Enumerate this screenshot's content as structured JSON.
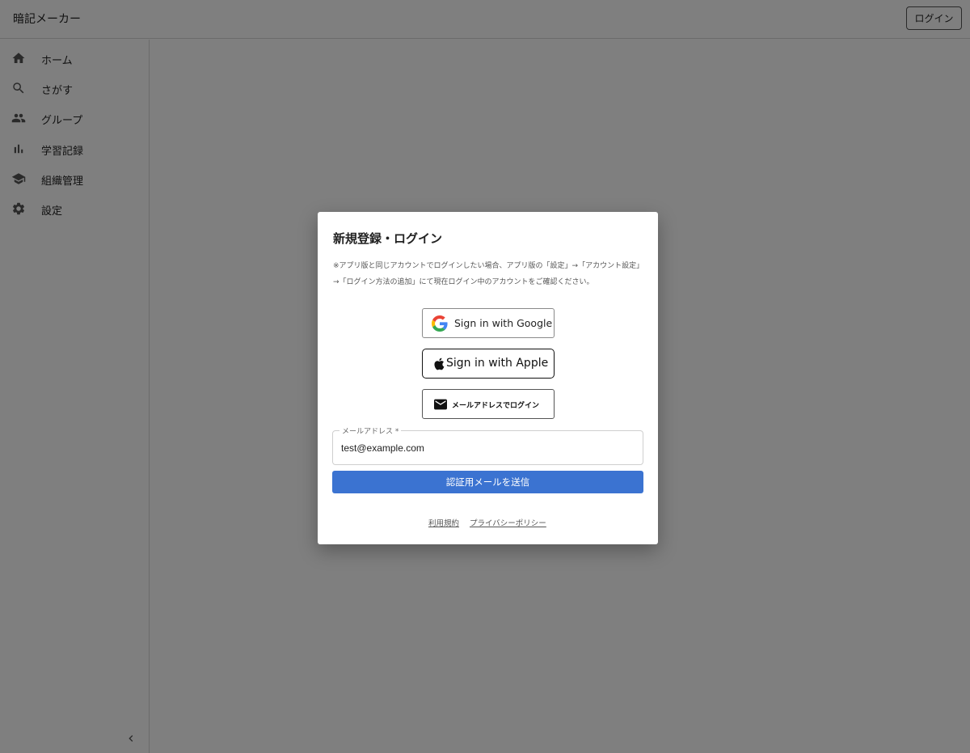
{
  "header": {
    "app_title": "暗記メーカー",
    "login_label": "ログイン"
  },
  "sidebar": {
    "items": [
      {
        "label": "ホーム",
        "icon": "home-icon"
      },
      {
        "label": "さがす",
        "icon": "search-icon"
      },
      {
        "label": "グループ",
        "icon": "group-icon"
      },
      {
        "label": "学習記録",
        "icon": "bar-chart-icon"
      },
      {
        "label": "組織管理",
        "icon": "school-icon"
      },
      {
        "label": "設定",
        "icon": "gear-icon"
      }
    ],
    "collapse_icon": "chevron-left-icon"
  },
  "dialog": {
    "title": "新規登録・ログイン",
    "note": "※アプリ版と同じアカウントでログインしたい場合、アプリ版の「設定」→「アカウント設定」→「ログイン方法の追加」にて現在ログイン中のアカウントをご確認ください。",
    "google_label": "Sign in with Google",
    "apple_label": "Sign in with Apple",
    "email_login_label": "メールアドレスでログイン",
    "email_field_label": "メールアドレス *",
    "email_value": "test@example.com",
    "submit_label": "認証用メールを送信",
    "terms_label": "利用規約",
    "privacy_label": "プライバシーポリシー"
  },
  "colors": {
    "primary": "#3b73d1",
    "overlay": "#808080"
  }
}
